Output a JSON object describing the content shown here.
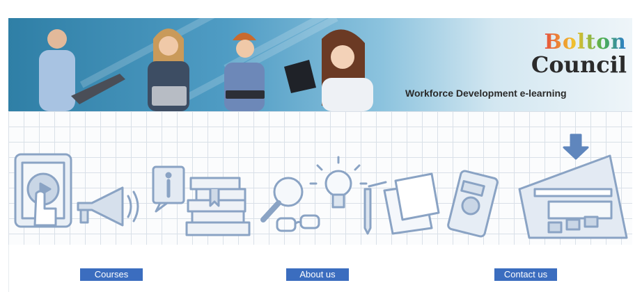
{
  "banner": {
    "logo_line1": "Bolton",
    "logo_line2": "Council",
    "tagline": "Workforce Development e-learning"
  },
  "illustration": {
    "icons": [
      "tablet-touch-icon",
      "megaphone-icon",
      "info-icon",
      "books-icon",
      "magnifier-icon",
      "glasses-icon",
      "lightbulb-icon",
      "pencil-paper-icon",
      "smartphone-icon",
      "laptop-icon",
      "download-arrow-icon"
    ]
  },
  "nav": {
    "courses": "Courses",
    "about": "About us",
    "contact": "Contact us"
  },
  "colors": {
    "button": "#3b6dbf",
    "banner_blue": "#2f7fa6",
    "line_art": "#8aa3c4"
  }
}
